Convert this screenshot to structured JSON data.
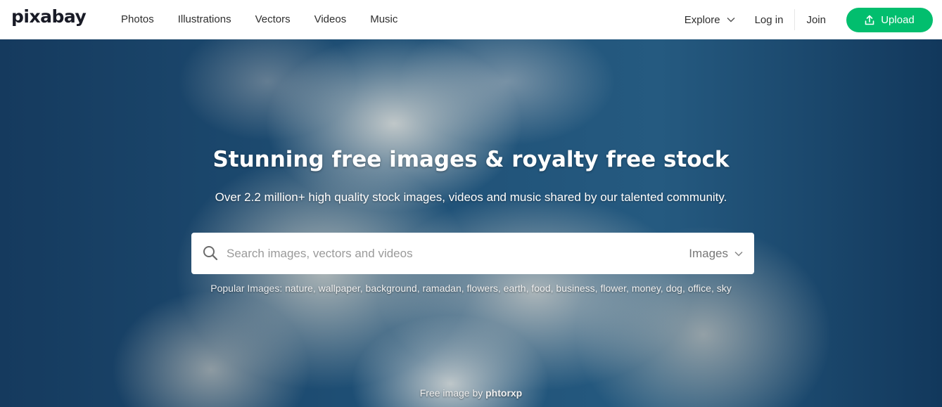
{
  "header": {
    "logo": "pixabay",
    "nav": [
      "Photos",
      "Illustrations",
      "Vectors",
      "Videos",
      "Music"
    ],
    "explore_label": "Explore",
    "login_label": "Log in",
    "join_label": "Join",
    "upload_label": "Upload",
    "upload_color": "#02be6e"
  },
  "hero": {
    "title": "Stunning free images & royalty free stock",
    "subtitle": "Over 2.2 million+ high quality stock images, videos and music shared by our talented community."
  },
  "search": {
    "placeholder": "Search images, vectors and videos",
    "value": "",
    "type_selected": "Images"
  },
  "popular": {
    "label": "Popular Images:",
    "tags": [
      "nature",
      "wallpaper",
      "background",
      "ramadan",
      "flowers",
      "earth",
      "food",
      "business",
      "flower",
      "money",
      "dog",
      "office",
      "sky"
    ]
  },
  "credit": {
    "prefix": "Free image by",
    "author": "phtorxp"
  },
  "icons": {
    "search": "search-icon",
    "explore_chevron": "chevron-down-icon",
    "select_chevron": "chevron-down-icon",
    "upload": "upload-icon"
  }
}
